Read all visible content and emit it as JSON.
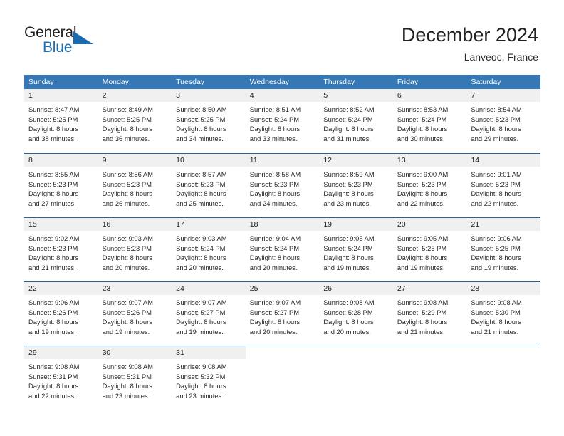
{
  "brand": {
    "name_top": "General",
    "name_bottom": "Blue"
  },
  "header": {
    "title": "December 2024",
    "subtitle": "Lanveoc, France"
  },
  "calendar": {
    "weekday_headers": [
      "Sunday",
      "Monday",
      "Tuesday",
      "Wednesday",
      "Thursday",
      "Friday",
      "Saturday"
    ],
    "colors": {
      "header_blue": "#3578b5",
      "row_divider_blue": "#2a6099",
      "day_band_gray": "#f0f0f0",
      "brand_blue": "#1f6fb4"
    },
    "weeks": [
      [
        {
          "day": "1",
          "sunrise": "Sunrise: 8:47 AM",
          "sunset": "Sunset: 5:25 PM",
          "daylight_line1": "Daylight: 8 hours",
          "daylight_line2": "and 38 minutes."
        },
        {
          "day": "2",
          "sunrise": "Sunrise: 8:49 AM",
          "sunset": "Sunset: 5:25 PM",
          "daylight_line1": "Daylight: 8 hours",
          "daylight_line2": "and 36 minutes."
        },
        {
          "day": "3",
          "sunrise": "Sunrise: 8:50 AM",
          "sunset": "Sunset: 5:25 PM",
          "daylight_line1": "Daylight: 8 hours",
          "daylight_line2": "and 34 minutes."
        },
        {
          "day": "4",
          "sunrise": "Sunrise: 8:51 AM",
          "sunset": "Sunset: 5:24 PM",
          "daylight_line1": "Daylight: 8 hours",
          "daylight_line2": "and 33 minutes."
        },
        {
          "day": "5",
          "sunrise": "Sunrise: 8:52 AM",
          "sunset": "Sunset: 5:24 PM",
          "daylight_line1": "Daylight: 8 hours",
          "daylight_line2": "and 31 minutes."
        },
        {
          "day": "6",
          "sunrise": "Sunrise: 8:53 AM",
          "sunset": "Sunset: 5:24 PM",
          "daylight_line1": "Daylight: 8 hours",
          "daylight_line2": "and 30 minutes."
        },
        {
          "day": "7",
          "sunrise": "Sunrise: 8:54 AM",
          "sunset": "Sunset: 5:23 PM",
          "daylight_line1": "Daylight: 8 hours",
          "daylight_line2": "and 29 minutes."
        }
      ],
      [
        {
          "day": "8",
          "sunrise": "Sunrise: 8:55 AM",
          "sunset": "Sunset: 5:23 PM",
          "daylight_line1": "Daylight: 8 hours",
          "daylight_line2": "and 27 minutes."
        },
        {
          "day": "9",
          "sunrise": "Sunrise: 8:56 AM",
          "sunset": "Sunset: 5:23 PM",
          "daylight_line1": "Daylight: 8 hours",
          "daylight_line2": "and 26 minutes."
        },
        {
          "day": "10",
          "sunrise": "Sunrise: 8:57 AM",
          "sunset": "Sunset: 5:23 PM",
          "daylight_line1": "Daylight: 8 hours",
          "daylight_line2": "and 25 minutes."
        },
        {
          "day": "11",
          "sunrise": "Sunrise: 8:58 AM",
          "sunset": "Sunset: 5:23 PM",
          "daylight_line1": "Daylight: 8 hours",
          "daylight_line2": "and 24 minutes."
        },
        {
          "day": "12",
          "sunrise": "Sunrise: 8:59 AM",
          "sunset": "Sunset: 5:23 PM",
          "daylight_line1": "Daylight: 8 hours",
          "daylight_line2": "and 23 minutes."
        },
        {
          "day": "13",
          "sunrise": "Sunrise: 9:00 AM",
          "sunset": "Sunset: 5:23 PM",
          "daylight_line1": "Daylight: 8 hours",
          "daylight_line2": "and 22 minutes."
        },
        {
          "day": "14",
          "sunrise": "Sunrise: 9:01 AM",
          "sunset": "Sunset: 5:23 PM",
          "daylight_line1": "Daylight: 8 hours",
          "daylight_line2": "and 22 minutes."
        }
      ],
      [
        {
          "day": "15",
          "sunrise": "Sunrise: 9:02 AM",
          "sunset": "Sunset: 5:23 PM",
          "daylight_line1": "Daylight: 8 hours",
          "daylight_line2": "and 21 minutes."
        },
        {
          "day": "16",
          "sunrise": "Sunrise: 9:03 AM",
          "sunset": "Sunset: 5:23 PM",
          "daylight_line1": "Daylight: 8 hours",
          "daylight_line2": "and 20 minutes."
        },
        {
          "day": "17",
          "sunrise": "Sunrise: 9:03 AM",
          "sunset": "Sunset: 5:24 PM",
          "daylight_line1": "Daylight: 8 hours",
          "daylight_line2": "and 20 minutes."
        },
        {
          "day": "18",
          "sunrise": "Sunrise: 9:04 AM",
          "sunset": "Sunset: 5:24 PM",
          "daylight_line1": "Daylight: 8 hours",
          "daylight_line2": "and 20 minutes."
        },
        {
          "day": "19",
          "sunrise": "Sunrise: 9:05 AM",
          "sunset": "Sunset: 5:24 PM",
          "daylight_line1": "Daylight: 8 hours",
          "daylight_line2": "and 19 minutes."
        },
        {
          "day": "20",
          "sunrise": "Sunrise: 9:05 AM",
          "sunset": "Sunset: 5:25 PM",
          "daylight_line1": "Daylight: 8 hours",
          "daylight_line2": "and 19 minutes."
        },
        {
          "day": "21",
          "sunrise": "Sunrise: 9:06 AM",
          "sunset": "Sunset: 5:25 PM",
          "daylight_line1": "Daylight: 8 hours",
          "daylight_line2": "and 19 minutes."
        }
      ],
      [
        {
          "day": "22",
          "sunrise": "Sunrise: 9:06 AM",
          "sunset": "Sunset: 5:26 PM",
          "daylight_line1": "Daylight: 8 hours",
          "daylight_line2": "and 19 minutes."
        },
        {
          "day": "23",
          "sunrise": "Sunrise: 9:07 AM",
          "sunset": "Sunset: 5:26 PM",
          "daylight_line1": "Daylight: 8 hours",
          "daylight_line2": "and 19 minutes."
        },
        {
          "day": "24",
          "sunrise": "Sunrise: 9:07 AM",
          "sunset": "Sunset: 5:27 PM",
          "daylight_line1": "Daylight: 8 hours",
          "daylight_line2": "and 19 minutes."
        },
        {
          "day": "25",
          "sunrise": "Sunrise: 9:07 AM",
          "sunset": "Sunset: 5:27 PM",
          "daylight_line1": "Daylight: 8 hours",
          "daylight_line2": "and 20 minutes."
        },
        {
          "day": "26",
          "sunrise": "Sunrise: 9:08 AM",
          "sunset": "Sunset: 5:28 PM",
          "daylight_line1": "Daylight: 8 hours",
          "daylight_line2": "and 20 minutes."
        },
        {
          "day": "27",
          "sunrise": "Sunrise: 9:08 AM",
          "sunset": "Sunset: 5:29 PM",
          "daylight_line1": "Daylight: 8 hours",
          "daylight_line2": "and 21 minutes."
        },
        {
          "day": "28",
          "sunrise": "Sunrise: 9:08 AM",
          "sunset": "Sunset: 5:30 PM",
          "daylight_line1": "Daylight: 8 hours",
          "daylight_line2": "and 21 minutes."
        }
      ],
      [
        {
          "day": "29",
          "sunrise": "Sunrise: 9:08 AM",
          "sunset": "Sunset: 5:31 PM",
          "daylight_line1": "Daylight: 8 hours",
          "daylight_line2": "and 22 minutes."
        },
        {
          "day": "30",
          "sunrise": "Sunrise: 9:08 AM",
          "sunset": "Sunset: 5:31 PM",
          "daylight_line1": "Daylight: 8 hours",
          "daylight_line2": "and 23 minutes."
        },
        {
          "day": "31",
          "sunrise": "Sunrise: 9:08 AM",
          "sunset": "Sunset: 5:32 PM",
          "daylight_line1": "Daylight: 8 hours",
          "daylight_line2": "and 23 minutes."
        },
        {
          "day": "",
          "sunrise": "",
          "sunset": "",
          "daylight_line1": "",
          "daylight_line2": ""
        },
        {
          "day": "",
          "sunrise": "",
          "sunset": "",
          "daylight_line1": "",
          "daylight_line2": ""
        },
        {
          "day": "",
          "sunrise": "",
          "sunset": "",
          "daylight_line1": "",
          "daylight_line2": ""
        },
        {
          "day": "",
          "sunrise": "",
          "sunset": "",
          "daylight_line1": "",
          "daylight_line2": ""
        }
      ]
    ]
  }
}
